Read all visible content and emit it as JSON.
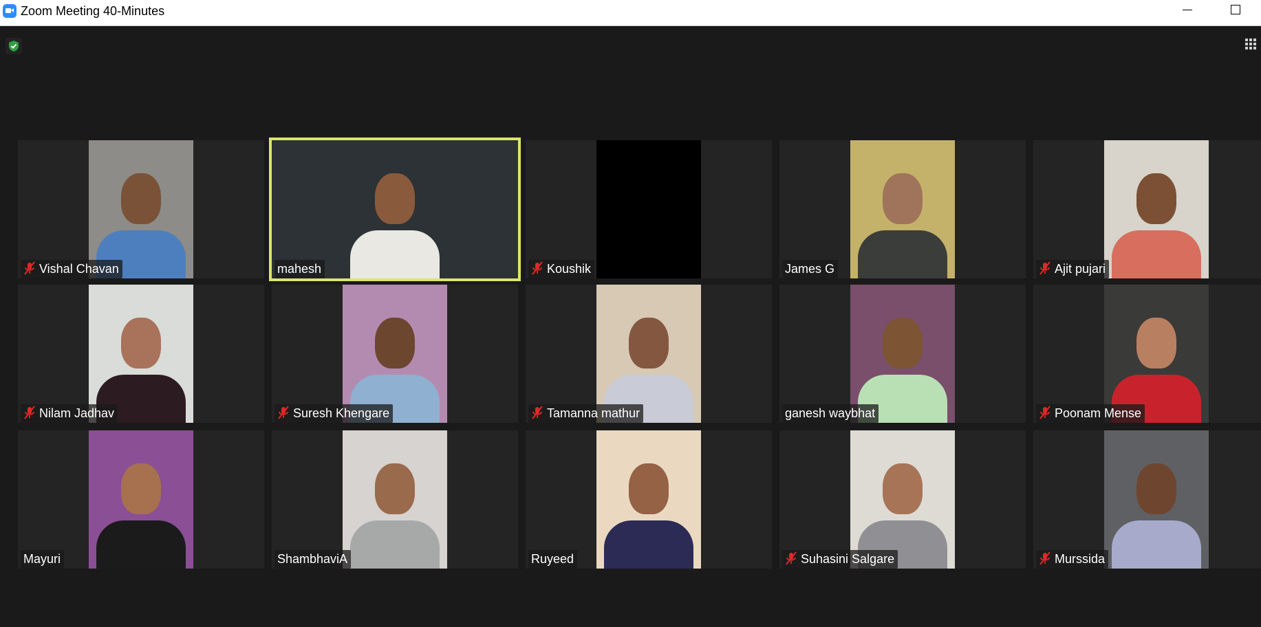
{
  "window": {
    "title": "Zoom Meeting 40-Minutes"
  },
  "colors": {
    "active_speaker": "#dbe66d",
    "muted": "#e02828",
    "secure": "#2ea043"
  },
  "participants": [
    {
      "name": "Vishal Chavan",
      "muted": true,
      "active": false,
      "bg": "#8d8c88",
      "skin": "#7a5238",
      "shirt": "#4d7fbf"
    },
    {
      "name": "mahesh",
      "muted": false,
      "active": true,
      "bg": "#2c3236",
      "skin": "#8a5a3c",
      "shirt": "#e9e8e3"
    },
    {
      "name": "Koushik",
      "muted": true,
      "active": false,
      "bg": "#000000",
      "skin": "",
      "shirt": ""
    },
    {
      "name": "James G",
      "muted": false,
      "active": false,
      "bg": "#c4b26a",
      "skin": "#a0745a",
      "shirt": "#3a3d3a"
    },
    {
      "name": "Ajit pujari",
      "muted": true,
      "active": false,
      "bg": "#d8d3cb",
      "skin": "#7b5034",
      "shirt": "#d86e5e"
    },
    {
      "name": "Nilam Jadhav",
      "muted": true,
      "active": false,
      "bg": "#d9dcd8",
      "skin": "#a8735a",
      "shirt": "#2c1c22"
    },
    {
      "name": "Suresh Khengare",
      "muted": true,
      "active": false,
      "bg": "#b48bb0",
      "skin": "#6d4630",
      "shirt": "#8fb0d0"
    },
    {
      "name": "Tamanna mathur",
      "muted": true,
      "active": false,
      "bg": "#d7c9b4",
      "skin": "#845840",
      "shirt": "#c9ccd6"
    },
    {
      "name": "ganesh waybhat",
      "muted": false,
      "active": false,
      "bg": "#7a4f6b",
      "skin": "#7d5434",
      "shirt": "#b9e0b4"
    },
    {
      "name": "Poonam Mense",
      "muted": true,
      "active": false,
      "bg": "#3a3a38",
      "skin": "#b88060",
      "shirt": "#c8232c"
    },
    {
      "name": "Mayuri",
      "muted": false,
      "active": false,
      "bg": "#8a4f95",
      "skin": "#a7704f",
      "shirt": "#1b1b1c"
    },
    {
      "name": "ShambhaviA",
      "muted": false,
      "active": false,
      "bg": "#d6d3d0",
      "skin": "#9a6a4d",
      "shirt": "#a7a9a9"
    },
    {
      "name": "Ruyeed",
      "muted": false,
      "active": false,
      "bg": "#ead9c0",
      "skin": "#956246",
      "shirt": "#2b2b56"
    },
    {
      "name": "Suhasini Salgare",
      "muted": true,
      "active": false,
      "bg": "#dedbd4",
      "skin": "#a87458",
      "shirt": "#8f8f94"
    },
    {
      "name": "Murssida",
      "muted": true,
      "active": false,
      "bg": "#5f6064",
      "skin": "#6e4630",
      "shirt": "#a7aacb"
    }
  ]
}
